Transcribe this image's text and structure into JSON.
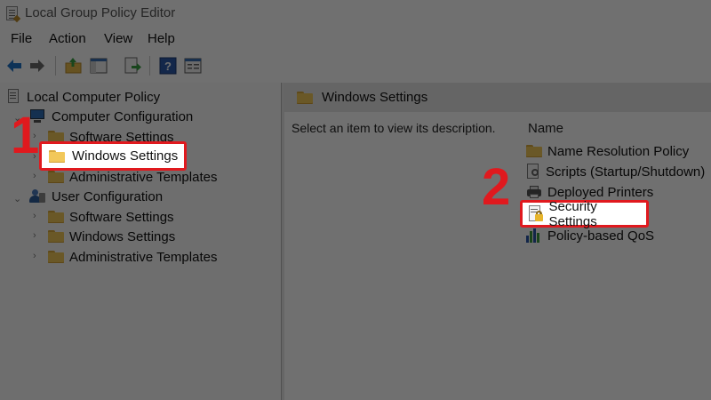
{
  "window": {
    "title": "Local Group Policy Editor"
  },
  "menu": [
    "File",
    "Action",
    "View",
    "Help"
  ],
  "toolbar": {
    "buttons": [
      "back-arrow-icon",
      "forward-arrow-icon",
      "up-folder-icon",
      "show-hide-tree-icon",
      "export-list-icon",
      "help-icon",
      "properties-icon"
    ]
  },
  "tree": {
    "root": "Local Computer Policy",
    "computer_config": {
      "label": "Computer Configuration",
      "children": [
        "Software Settings",
        "Windows Settings",
        "Administrative Templates"
      ]
    },
    "user_config": {
      "label": "User Configuration",
      "children": [
        "Software Settings",
        "Windows Settings",
        "Administrative Templates"
      ]
    }
  },
  "details": {
    "header": "Windows Settings",
    "description": "Select an item to view its description.",
    "column_name": "Name",
    "items": [
      "Name Resolution Policy",
      "Scripts (Startup/Shutdown)",
      "Deployed Printers",
      "Security Settings",
      "Policy-based QoS"
    ]
  },
  "annotations": {
    "step1": "1",
    "step2": "2",
    "highlight_color": "#e0191e"
  }
}
